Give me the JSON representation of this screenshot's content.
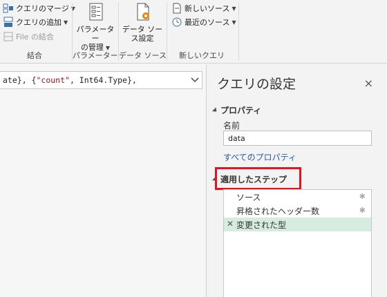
{
  "ribbon": {
    "combine_group": {
      "merge_queries": "クエリのマージ",
      "append_queries": "クエリの追加",
      "combine_files": "File の結合",
      "label": "結合"
    },
    "params_group": {
      "manage_params_line1": "パラメーター",
      "manage_params_line2": "の管理",
      "label": "パラメーター"
    },
    "datasource_group": {
      "settings_line1": "データ ソー",
      "settings_line2": "ス設定",
      "label": "データ ソース"
    },
    "newquery_group": {
      "new_source": "新しいソース",
      "recent_sources": "最近のソース",
      "label": "新しいクエリ"
    }
  },
  "formula": {
    "text_part1": "ate}, {",
    "text_str": "\"count\"",
    "text_part2": ", Int64.Type},"
  },
  "query_settings": {
    "title": "クエリの設定",
    "close_glyph": "×",
    "properties_header": "プロパティ",
    "name_label": "名前",
    "name_value": "data",
    "all_properties_link": "すべてのプロパティ",
    "applied_steps_header": "適用したステップ",
    "steps": [
      {
        "label": "ソース",
        "has_gear": true,
        "active": false
      },
      {
        "label": "昇格されたヘッダー数",
        "has_gear": true,
        "active": false
      },
      {
        "label": "変更された型",
        "has_gear": false,
        "active": true
      }
    ],
    "highlight_color": "#e3141b",
    "active_step_color": "#d5ecdf"
  }
}
